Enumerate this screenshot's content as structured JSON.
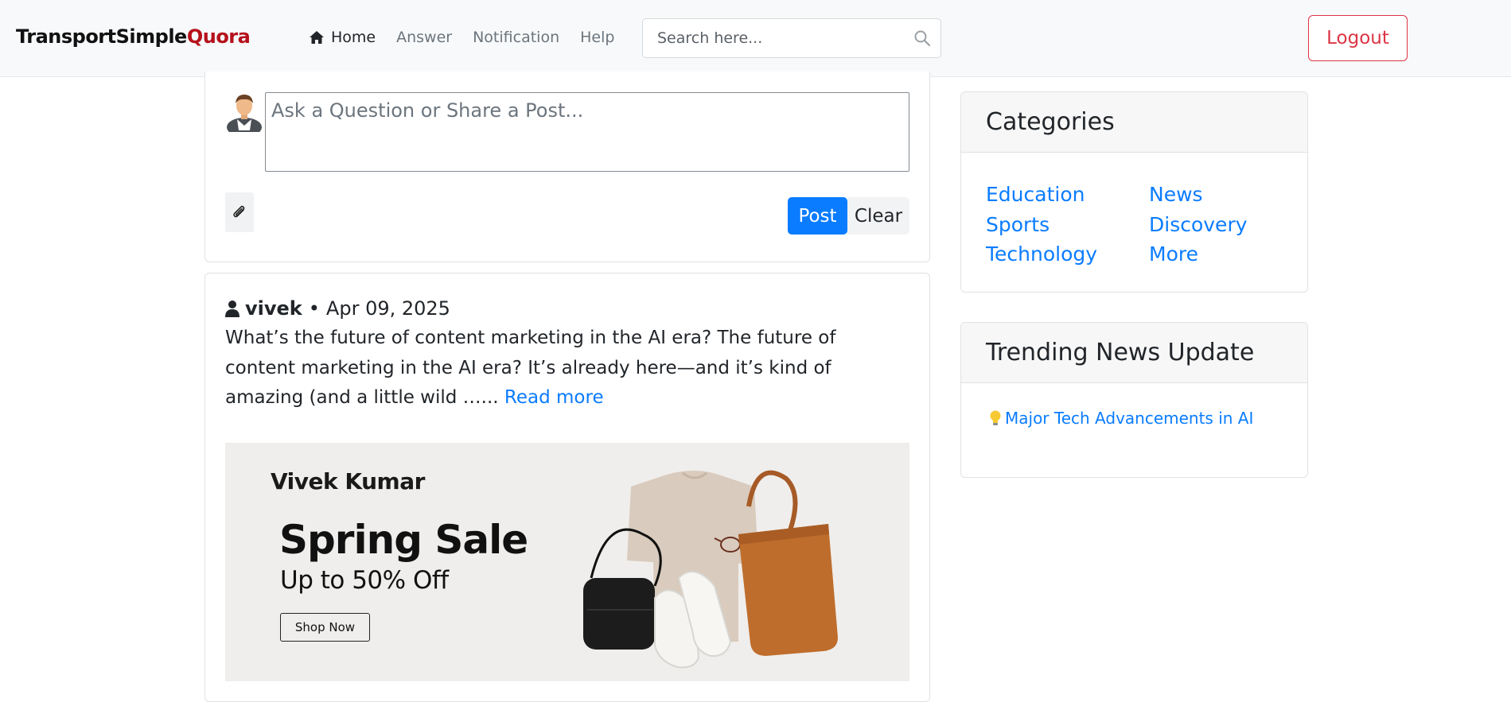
{
  "navbar": {
    "brand_main": "TransportSimple",
    "brand_accent": "Quora",
    "links": [
      {
        "label": "Home"
      },
      {
        "label": "Answer"
      },
      {
        "label": "Notification"
      },
      {
        "label": "Help"
      }
    ],
    "search_placeholder": "Search here...",
    "logout_label": "Logout"
  },
  "composer": {
    "placeholder": "Ask a Question or Share a Post...",
    "post_label": "Post",
    "clear_label": "Clear"
  },
  "post": {
    "author": "vivek",
    "separator": "•",
    "date": "Apr 09, 2025",
    "excerpt": "What’s the future of content marketing in the AI era? The future of content marketing in the AI era? It’s already here—and it’s kind of amazing (and a little wild …...",
    "read_more": "Read more",
    "ad": {
      "brand": "Vivek Kumar",
      "title": "Spring Sale",
      "subtitle": "Up to 50% Off",
      "cta": "Shop Now"
    }
  },
  "categories": {
    "title": "Categories",
    "items": [
      "Education",
      "News",
      "Sports",
      "Discovery",
      "Technology",
      "More"
    ]
  },
  "trending": {
    "title": "Trending News Update",
    "items": [
      {
        "icon": "lightbulb-icon",
        "label": "Major Tech Advancements in AI"
      }
    ]
  },
  "colors": {
    "brand_accent": "#b5121b",
    "primary": "#0a7cff",
    "danger": "#dc3545"
  }
}
